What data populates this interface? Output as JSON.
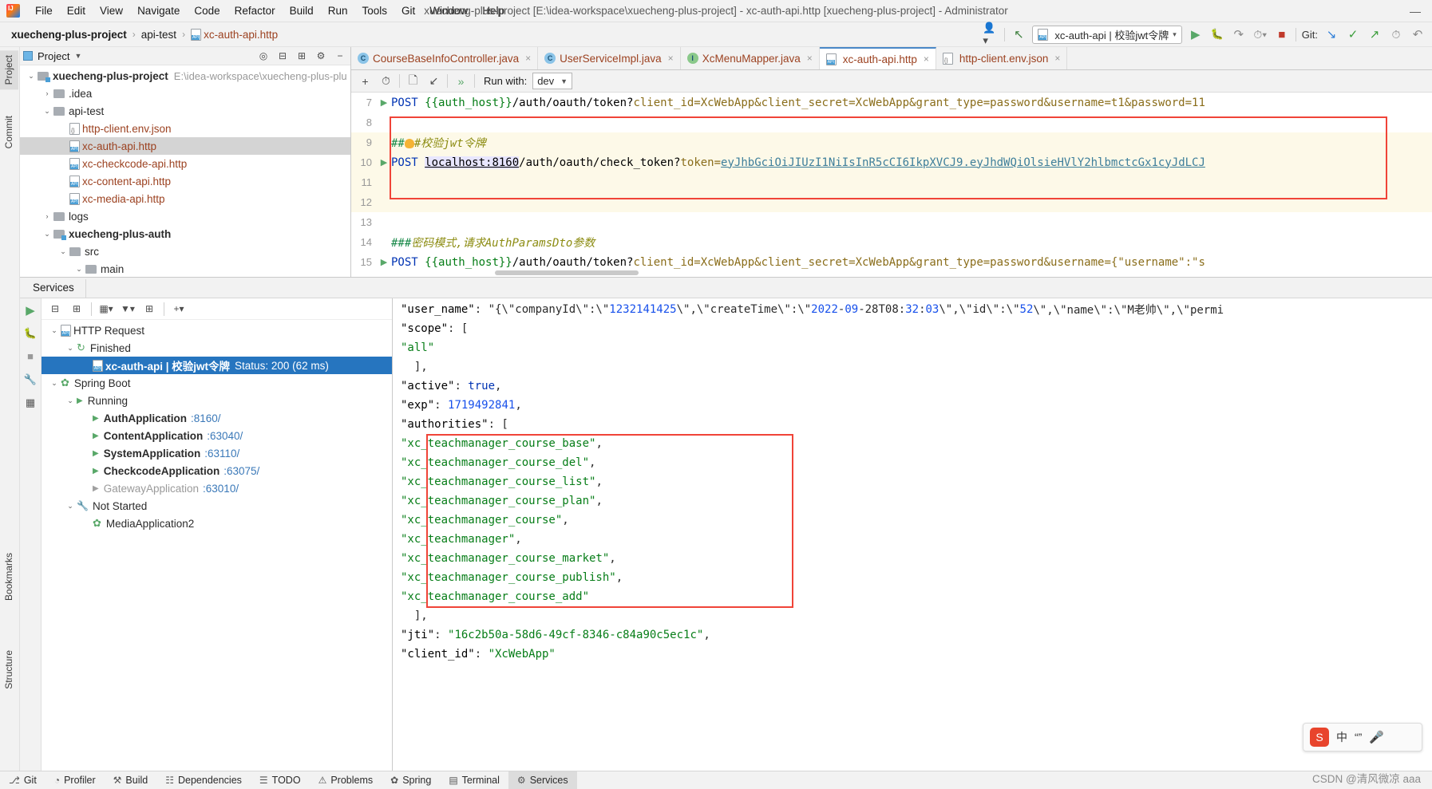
{
  "window": {
    "title": "xuecheng-plus-project [E:\\idea-workspace\\xuecheng-plus-project] - xc-auth-api.http [xuecheng-plus-project] - Administrator",
    "minimize_label": "—",
    "logo_name": "intellij-idea-logo"
  },
  "menubar": {
    "items": [
      "File",
      "Edit",
      "View",
      "Navigate",
      "Code",
      "Refactor",
      "Build",
      "Run",
      "Tools",
      "Git",
      "Window",
      "Help"
    ]
  },
  "breadcrumb": {
    "project": "xuecheng-plus-project",
    "folder": "api-test",
    "file": "xc-auth-api.http",
    "separator": "›"
  },
  "toolbar_right": {
    "run_config": "xc-auth-api | 校验jwt令牌",
    "git_label": "Git:",
    "icons": [
      "user-icon",
      "back-arrow-icon",
      "run-icon",
      "debug-icon",
      "run-with-coverage-icon",
      "profile-icon",
      "stop-icon",
      "git-update-icon",
      "git-commit-icon",
      "git-push-icon",
      "git-history-icon",
      "git-rollback-icon"
    ]
  },
  "left_strip": {
    "tabs": [
      "Project",
      "Commit",
      "Bookmarks",
      "Structure"
    ]
  },
  "project_panel": {
    "title": "Project",
    "header_icons": [
      "locate-icon",
      "expand-all-icon",
      "collapse-all-icon",
      "settings-icon",
      "hide-icon"
    ],
    "tree": [
      {
        "indent": 0,
        "arrow": "⌄",
        "icon": "module-folder",
        "label": "xuecheng-plus-project",
        "bold": true,
        "path": "E:\\idea-workspace\\xuecheng-plus-plu",
        "selected": false
      },
      {
        "indent": 1,
        "arrow": "›",
        "icon": "folder",
        "label": ".idea",
        "bold": false,
        "path": "",
        "selected": false
      },
      {
        "indent": 1,
        "arrow": "⌄",
        "icon": "folder",
        "label": "api-test",
        "bold": false,
        "path": "",
        "selected": false
      },
      {
        "indent": 2,
        "arrow": "",
        "icon": "json-file",
        "label": "http-client.env.json",
        "bold": false,
        "path": "",
        "selected": false,
        "file": true
      },
      {
        "indent": 2,
        "arrow": "",
        "icon": "api-file",
        "label": "xc-auth-api.http",
        "bold": false,
        "path": "",
        "selected": true,
        "file": true
      },
      {
        "indent": 2,
        "arrow": "",
        "icon": "api-file",
        "label": "xc-checkcode-api.http",
        "bold": false,
        "path": "",
        "selected": false,
        "file": true
      },
      {
        "indent": 2,
        "arrow": "",
        "icon": "api-file",
        "label": "xc-content-api.http",
        "bold": false,
        "path": "",
        "selected": false,
        "file": true
      },
      {
        "indent": 2,
        "arrow": "",
        "icon": "api-file",
        "label": "xc-media-api.http",
        "bold": false,
        "path": "",
        "selected": false,
        "file": true
      },
      {
        "indent": 1,
        "arrow": "›",
        "icon": "folder",
        "label": "logs",
        "bold": false,
        "path": "",
        "selected": false
      },
      {
        "indent": 1,
        "arrow": "⌄",
        "icon": "module-folder",
        "label": "xuecheng-plus-auth",
        "bold": true,
        "path": "",
        "selected": false
      },
      {
        "indent": 2,
        "arrow": "⌄",
        "icon": "folder",
        "label": "src",
        "bold": false,
        "path": "",
        "selected": false
      },
      {
        "indent": 3,
        "arrow": "⌄",
        "icon": "folder",
        "label": "main",
        "bold": false,
        "path": "",
        "selected": false
      }
    ]
  },
  "editor": {
    "tabs": [
      {
        "label": "CourseBaseInfoController.java",
        "icon": "class-icon",
        "icon_letter": "C",
        "active": false
      },
      {
        "label": "UserServiceImpl.java",
        "icon": "class-icon",
        "icon_letter": "C",
        "active": false
      },
      {
        "label": "XcMenuMapper.java",
        "icon": "interface-icon",
        "icon_letter": "I",
        "active": false
      },
      {
        "label": "xc-auth-api.http",
        "icon": "api-file-icon",
        "icon_letter": "",
        "active": true
      },
      {
        "label": "http-client.env.json",
        "icon": "json-file-icon",
        "icon_letter": "",
        "active": false
      }
    ],
    "run_bar": {
      "icons": [
        "add-icon",
        "history-icon",
        "copy-icon",
        "import-icon",
        "run-all-icon"
      ],
      "run_with_label": "Run with:",
      "env_value": "dev"
    },
    "lines": [
      {
        "num": "7",
        "runnable": true,
        "text": "POST {{auth_host}}/auth/oauth/token?client_id=XcWebApp&client_secret=XcWebApp&grant_type=password&username=t1&password=11"
      },
      {
        "num": "8",
        "runnable": false,
        "text": ""
      },
      {
        "num": "9",
        "runnable": false,
        "text": "###校验jwt令牌"
      },
      {
        "num": "10",
        "runnable": true,
        "text": "POST localhost:8160/auth/oauth/check_token?token=eyJhbGciOiJIUzI1NiIsInR5cCI6IkpXVCJ9.eyJhdWQiOlsieEVVlY2hlbmctGx1cyJdLCJ"
      },
      {
        "num": "11",
        "runnable": false,
        "text": ""
      },
      {
        "num": "12",
        "runnable": false,
        "text": ""
      },
      {
        "num": "13",
        "runnable": false,
        "text": ""
      },
      {
        "num": "14",
        "runnable": false,
        "text": "###密码模式,请求AuthParamsDto参数"
      },
      {
        "num": "15",
        "runnable": true,
        "text": "POST {{auth_host}}/auth/oauth/token?client_id=XcWebApp&client_secret=XcWebApp&grant_type=password&username={\"username\":\"s"
      }
    ],
    "line10_parts": {
      "method": "POST",
      "host": "localhost:8160",
      "path": "/auth/oauth/check_token?",
      "param": "token=",
      "value": "eyJhbGciOiJIUzI1NiIsInR5cCI6IkpXVCJ9.eyJhdWQiOlsieHVlY2hlbmctcGx1cyJdLCJ"
    },
    "line7_parts": {
      "method": "POST",
      "host": "{{auth_host}}",
      "path": "/auth/oauth/token?",
      "rest": "client_id=XcWebApp&client_secret=XcWebApp&grant_type=password&username=t1&password=11"
    },
    "line15_parts": {
      "method": "POST",
      "host": "{{auth_host}}",
      "path": "/auth/oauth/token?",
      "rest": "client_id=XcWebApp&client_secret=XcWebApp&grant_type=password&username={\"username\":\"s"
    },
    "comment9": "###校验jwt令牌",
    "comment14": "###密码模式,请求AuthParamsDto参数"
  },
  "services": {
    "tab_label": "Services",
    "side_icons": [
      "run-icon",
      "debug-icon",
      "stop-icon",
      "settings-wrench-icon",
      "layout-icon"
    ],
    "tree_tool_icons": [
      "expand-all-icon",
      "collapse-all-icon",
      "group-icon",
      "filter-icon",
      "add-tab-icon",
      "add-icon"
    ],
    "tree": [
      {
        "indent": 0,
        "arrow": "⌄",
        "icon": "api-icon",
        "label": "HTTP Request",
        "bold": false,
        "suffix": "",
        "selected": false
      },
      {
        "indent": 1,
        "arrow": "⌄",
        "icon": "finished-icon",
        "label": "Finished",
        "bold": false,
        "suffix": "",
        "selected": false
      },
      {
        "indent": 2,
        "arrow": "",
        "icon": "api-icon",
        "label": "xc-auth-api  |  校验jwt令牌",
        "bold": true,
        "suffix": "Status: 200 (62 ms)",
        "selected": true
      },
      {
        "indent": 0,
        "arrow": "⌄",
        "icon": "springboot-icon",
        "label": "Spring Boot",
        "bold": false,
        "suffix": "",
        "selected": false
      },
      {
        "indent": 1,
        "arrow": "⌄",
        "icon": "run-green-icon",
        "label": "Running",
        "bold": false,
        "suffix": "",
        "selected": false
      },
      {
        "indent": 2,
        "arrow": "",
        "icon": "run-green-icon",
        "label": "AuthApplication",
        "bold": true,
        "suffix": ":8160/",
        "selected": false
      },
      {
        "indent": 2,
        "arrow": "",
        "icon": "run-green-icon",
        "label": "ContentApplication",
        "bold": true,
        "suffix": ":63040/",
        "selected": false
      },
      {
        "indent": 2,
        "arrow": "",
        "icon": "run-green-icon",
        "label": "SystemApplication",
        "bold": true,
        "suffix": ":63110/",
        "selected": false
      },
      {
        "indent": 2,
        "arrow": "",
        "icon": "run-green-icon",
        "label": "CheckcodeApplication",
        "bold": true,
        "suffix": ":63075/",
        "selected": false
      },
      {
        "indent": 2,
        "arrow": "",
        "icon": "run-grey-icon",
        "label": "GatewayApplication",
        "bold": false,
        "suffix": ":63010/",
        "selected": false,
        "dimmed": true
      },
      {
        "indent": 1,
        "arrow": "⌄",
        "icon": "wrench-icon",
        "label": "Not Started",
        "bold": false,
        "suffix": "",
        "selected": false
      },
      {
        "indent": 2,
        "arrow": "",
        "icon": "springboot-icon",
        "label": "MediaApplication2",
        "bold": false,
        "suffix": "",
        "selected": false
      }
    ],
    "output_lines": [
      "  \"user_name\": \"{\\\"companyId\\\":\\\"1232141425\\\",\\\"createTime\\\":\\\"2022-09-28T08:32:03\\\",\\\"id\\\":\\\"52\\\",\\\"name\\\":\\\"M老帅\\\",\\\"permi",
      "  \"scope\": [",
      "    \"all\"",
      "  ],",
      "  \"active\": true,",
      "  \"exp\": 1719492841,",
      "  \"authorities\": [",
      "    \"xc_teachmanager_course_base\",",
      "    \"xc_teachmanager_course_del\",",
      "    \"xc_teachmanager_course_list\",",
      "    \"xc_teachmanager_course_plan\",",
      "    \"xc_teachmanager_course\",",
      "    \"xc_teachmanager\",",
      "    \"xc_teachmanager_course_market\",",
      "    \"xc_teachmanager_course_publish\",",
      "    \"xc_teachmanager_course_add\"",
      "  ],",
      "  \"jti\": \"16c2b50a-58d6-49cf-8346-c84a90c5ec1c\",",
      "  \"client_id\": \"XcWebApp\""
    ]
  },
  "statusbar": {
    "items": [
      {
        "label": "Git",
        "icon": "git-icon",
        "active": false
      },
      {
        "label": "Profiler",
        "icon": "profiler-icon",
        "active": false
      },
      {
        "label": "Build",
        "icon": "build-icon",
        "active": false
      },
      {
        "label": "Dependencies",
        "icon": "dependencies-icon",
        "active": false
      },
      {
        "label": "TODO",
        "icon": "todo-icon",
        "active": false
      },
      {
        "label": "Problems",
        "icon": "problems-icon",
        "active": false
      },
      {
        "label": "Spring",
        "icon": "spring-icon",
        "active": false
      },
      {
        "label": "Terminal",
        "icon": "terminal-icon",
        "active": false
      },
      {
        "label": "Services",
        "icon": "services-icon",
        "active": true
      }
    ]
  },
  "ime": {
    "logo": "S",
    "mode": "中",
    "comma": "“”",
    "mic": "mic-icon"
  },
  "watermark": "CSDN @清风微凉 aaa",
  "colors": {
    "accent_blue": "#2675bf",
    "highlight_red": "#f04438",
    "green_run": "#59a869",
    "file_orange": "#9c4221"
  }
}
